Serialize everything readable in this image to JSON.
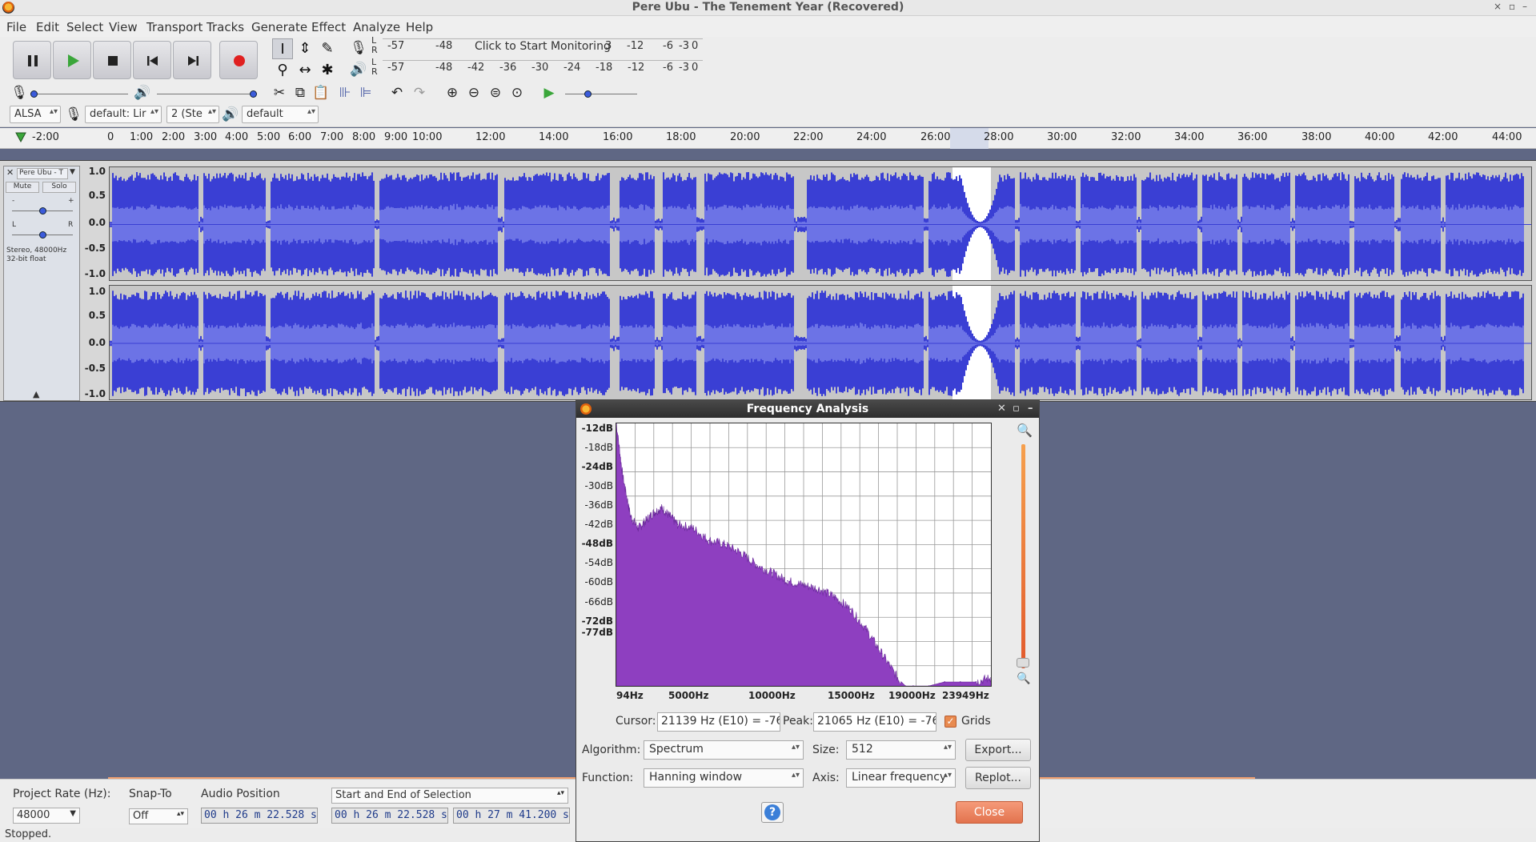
{
  "window": {
    "title": "Pere Ubu - The Tenement Year (Recovered)",
    "controls": [
      "×",
      "▫",
      "–"
    ]
  },
  "menu": [
    "File",
    "Edit",
    "Select",
    "View",
    "Transport",
    "Tracks",
    "Generate",
    "Effect",
    "Analyze",
    "Help"
  ],
  "meters": {
    "record_ticks": [
      "-57",
      "-48"
    ],
    "record_prompt": "Click to Start Monitoring",
    "record_ticks_right": [
      "3",
      "-12",
      "-6",
      "-3",
      "0"
    ],
    "play_ticks": [
      "-57",
      "-48",
      "-42",
      "-36",
      "-30",
      "-24",
      "-18",
      "-12",
      "-6",
      "-3",
      "0"
    ],
    "lr": [
      "L",
      "R"
    ]
  },
  "devices": {
    "host": "ALSA",
    "recording_device": "default: Lir",
    "channels": "2 (Ste",
    "playback_device": "default"
  },
  "ruler": {
    "ticks": [
      "-2:00",
      "0",
      "1:00",
      "2:00",
      "3:00",
      "4:00",
      "5:00",
      "6:00",
      "7:00",
      "8:00",
      "9:00",
      "10:00",
      "12:00",
      "14:00",
      "16:00",
      "18:00",
      "20:00",
      "22:00",
      "24:00",
      "26:00",
      "28:00",
      "30:00",
      "32:00",
      "34:00",
      "36:00",
      "38:00",
      "40:00",
      "42:00",
      "44:00"
    ]
  },
  "track": {
    "name": "Pere Ubu - T",
    "mute": "Mute",
    "solo": "Solo",
    "gain_minus": "-",
    "gain_plus": "+",
    "pan_left": "L",
    "pan_right": "R",
    "info_rate": "Stereo, 48000Hz",
    "info_format": "32-bit float",
    "scale": [
      "1.0",
      "0.5",
      "0.0",
      "-0.5",
      "-1.0"
    ],
    "wave_color": "#3a3fd4",
    "wave_rms_color": "#6c73e6"
  },
  "selection_toolbar": {
    "project_rate_label": "Project Rate (Hz):",
    "project_rate": "48000",
    "snap_label": "Snap-To",
    "snap_value": "Off",
    "audio_position_label": "Audio Position",
    "audio_position": "00 h 26 m 22.528 s",
    "selection_mode": "Start and End of Selection",
    "selection_start": "00 h 26 m 22.528 s",
    "selection_end": "00 h 27 m 41.200 s"
  },
  "status": "Stopped.",
  "dialog": {
    "title": "Frequency Analysis",
    "y_labels": [
      "-12dB",
      "-18dB",
      "-24dB",
      "-30dB",
      "-36dB",
      "-42dB",
      "-48dB",
      "-54dB",
      "-60dB",
      "-66dB",
      "-72dB",
      "-77dB"
    ],
    "x_labels": [
      "94Hz",
      "5000Hz",
      "10000Hz",
      "15000Hz",
      "19000Hz",
      "23949Hz"
    ],
    "cursor_label": "Cursor:",
    "cursor_value": "21139 Hz (E10) = -76",
    "peak_label": "Peak:",
    "peak_value": "21065 Hz (E10) = -76",
    "grids_label": "Grids",
    "grids_checked": true,
    "algorithm_label": "Algorithm:",
    "algorithm_value": "Spectrum",
    "size_label": "Size:",
    "size_value": "512",
    "export_label": "Export...",
    "function_label": "Function:",
    "function_value": "Hanning window",
    "axis_label": "Axis:",
    "axis_value": "Linear frequency",
    "replot_label": "Replot...",
    "close_label": "Close",
    "help_label": "?",
    "spectrum_color": "#8e3fc0",
    "accent_color": "#e2734e"
  },
  "chart_data": {
    "type": "area",
    "x": [
      94,
      500,
      1000,
      1500,
      2000,
      2500,
      3000,
      3500,
      4000,
      5000,
      6000,
      7000,
      8000,
      9000,
      10000,
      11000,
      12000,
      13000,
      14000,
      15000,
      16000,
      17000,
      18000,
      18500,
      19000,
      20000,
      21000,
      22000,
      23000,
      23949
    ],
    "values": [
      -12,
      -25,
      -35,
      -38,
      -36,
      -34,
      -33,
      -35,
      -37,
      -38,
      -41,
      -42,
      -44,
      -47,
      -49,
      -51,
      -52,
      -53,
      -55,
      -58,
      -63,
      -69,
      -75,
      -77,
      -77,
      -77,
      -76,
      -76,
      -76,
      -75
    ],
    "xlabel": "",
    "ylabel": "",
    "xlim": [
      94,
      23949
    ],
    "ylim": [
      -77,
      -12
    ],
    "grid": true
  }
}
